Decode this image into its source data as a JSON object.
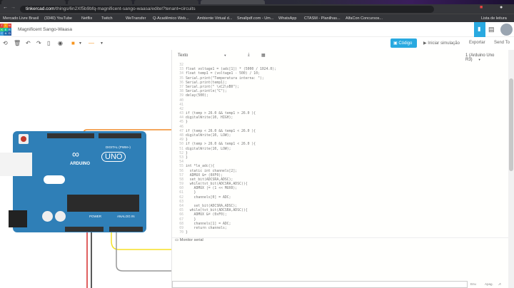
{
  "browser": {
    "url_host": "tinkercad.com",
    "url_path": "/things/6n2Xf5b9bfq-magnificent-sango-waasa/editel?tenant=circuits",
    "bookmarks": [
      "Mercado Livre Brasil",
      "(3340) YouTube",
      "Netflix",
      "Twitch",
      "WeTransfer",
      "Q-Acadêmico Web...",
      "Ambiente Virtual d...",
      "Smallpdf.com - Um...",
      "WhatsApp",
      "CTASM - Planilhas...",
      "AlfaCon Concursos...",
      "Lista de leitura"
    ]
  },
  "app": {
    "logo_letters": [
      "T",
      "I",
      "N",
      "K",
      "E",
      "R",
      "C",
      "A",
      "D"
    ],
    "title": "Magnificent Sango-Waasa",
    "accent": "#29a9e0"
  },
  "toolbar": {
    "code_label": "Código",
    "start_sim": "Iniciar simulação",
    "export": "Exportar",
    "send_to": "Send To"
  },
  "code_panel": {
    "mode": "Texto",
    "device": "1 (Arduino Uno R3)",
    "lines": [
      [
        "32",
        ""
      ],
      [
        "33",
        "float voltage1 = (adc[1]) * (5000 / 1024.0);"
      ],
      [
        "34",
        "float temp1 = (voltage1 - 500) / 10;"
      ],
      [
        "35",
        "Serial.print(\"Temperatura interna: \");"
      ],
      [
        "36",
        "Serial.print(temp1);"
      ],
      [
        "37",
        "Serial.print(\" \\xC2\\xB0\");"
      ],
      [
        "38",
        "Serial.println(\"C\");"
      ],
      [
        "39",
        "delay(500);"
      ],
      [
        "40",
        ""
      ],
      [
        "41",
        ""
      ],
      [
        "42",
        ""
      ],
      [
        "43",
        "if (temp > 26.0 && temp1 > 26.0 ){"
      ],
      [
        "44",
        "digitalWrite(10, HIGH);"
      ],
      [
        "45",
        "}"
      ],
      [
        "46",
        ""
      ],
      [
        "47",
        "if (temp < 26.0 && temp1 < 26.0 ){"
      ],
      [
        "48",
        "digitalWrite(10, LOW);"
      ],
      [
        "49",
        "}"
      ],
      [
        "50",
        "if (temp > 26.0 && temp1 < 26.0 ){"
      ],
      [
        "51",
        "digitalWrite(10, LOW);"
      ],
      [
        "52",
        "}"
      ],
      [
        "53",
        "}"
      ],
      [
        "54",
        ""
      ],
      [
        "55",
        "int *le_adc(){"
      ],
      [
        "56",
        "  static int channels[2];"
      ],
      [
        "57",
        "  ADMUX &= (0XF0);"
      ],
      [
        "58",
        "  set_bit(ADCSRA,ADSC);"
      ],
      [
        "59",
        "  while(tst_bit(ADCSRA,ADSC)){"
      ],
      [
        "60",
        "    ADMUX |= (1 << MUX0);"
      ],
      [
        "61",
        "    }"
      ],
      [
        "62",
        "    channels[0] = ADC;"
      ],
      [
        "63",
        ""
      ],
      [
        "64",
        "    set_bit(ADCSRA,ADSC);"
      ],
      [
        "65",
        "  while(tst_bit(ADCSRA,ADSC)){"
      ],
      [
        "66",
        "    ADMUX &= (0xF0);"
      ],
      [
        "67",
        "    }"
      ],
      [
        "68",
        "    channels[1] = ADC;"
      ],
      [
        "69",
        "    return channels;"
      ],
      [
        "70",
        "}"
      ]
    ]
  },
  "serial": {
    "label": "Monitor serial",
    "send": "Env.",
    "clear": "Apag."
  },
  "board": {
    "brand": "ARDUINO",
    "model": "UNO",
    "digital": "DIGITAL (PWM~)",
    "power": "POWER",
    "analog": "ANALOG IN"
  }
}
